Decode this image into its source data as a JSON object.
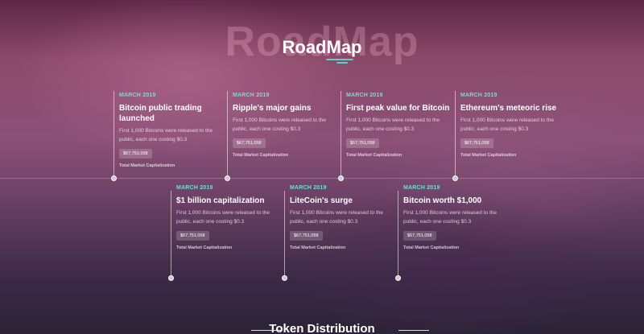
{
  "section": {
    "watermark": "RoadMap",
    "title": "RoadMap"
  },
  "milestones_top": [
    {
      "date": "MARCH 2019",
      "title": "Bitcoin public trading launched",
      "description": "First 1,000 Bitcoins were released to the public, each one costing $0.3",
      "value": "$67,751,058",
      "caption": "Total Market Capitalization"
    },
    {
      "date": "MARCH 2019",
      "title": "Ripple's major gains",
      "description": "First 1,000 Bitcoins were released to the public, each one costing $0.3",
      "value": "$67,751,058",
      "caption": "Total Market Capitalization"
    },
    {
      "date": "MARCH 2019",
      "title": "First peak value for Bitcoin",
      "description": "First 1,000 Bitcoins were released to the public, each one costing $0.3",
      "value": "$67,751,058",
      "caption": "Total Market Capitalization"
    },
    {
      "date": "MARCH 2019",
      "title": "Ethereum's meteoric rise",
      "description": "First 1,000 Bitcoins were released to the public, each one costing $0.3",
      "value": "$67,751,058",
      "caption": "Total Market Capitalization"
    }
  ],
  "milestones_bottom": [
    {
      "date": "MARCH 2019",
      "title": "$1 billion capitalization",
      "description": "First 1,000 Bitcoins were released to the public, each one costing $0.3",
      "value": "$67,751,058",
      "caption": "Total Market Capitalization"
    },
    {
      "date": "MARCH 2019",
      "title": "LiteCoin's surge",
      "description": "First 1,000 Bitcoins were released to the public, each one costing $0.3",
      "value": "$67,751,058",
      "caption": "Total Market Capitalization"
    },
    {
      "date": "MARCH 2019",
      "title": "Bitcoin worth $1,000",
      "description": "First 1,000 Bitcoins were released to the public, each one costing $0.3",
      "value": "$67,751,058",
      "caption": "Total Market Capitalization"
    }
  ],
  "next_section": {
    "title": "Token Distribution"
  },
  "colors": {
    "accent": "#6ee0d0",
    "background_top": "#5f2747",
    "background_bottom": "#2b2336"
  }
}
